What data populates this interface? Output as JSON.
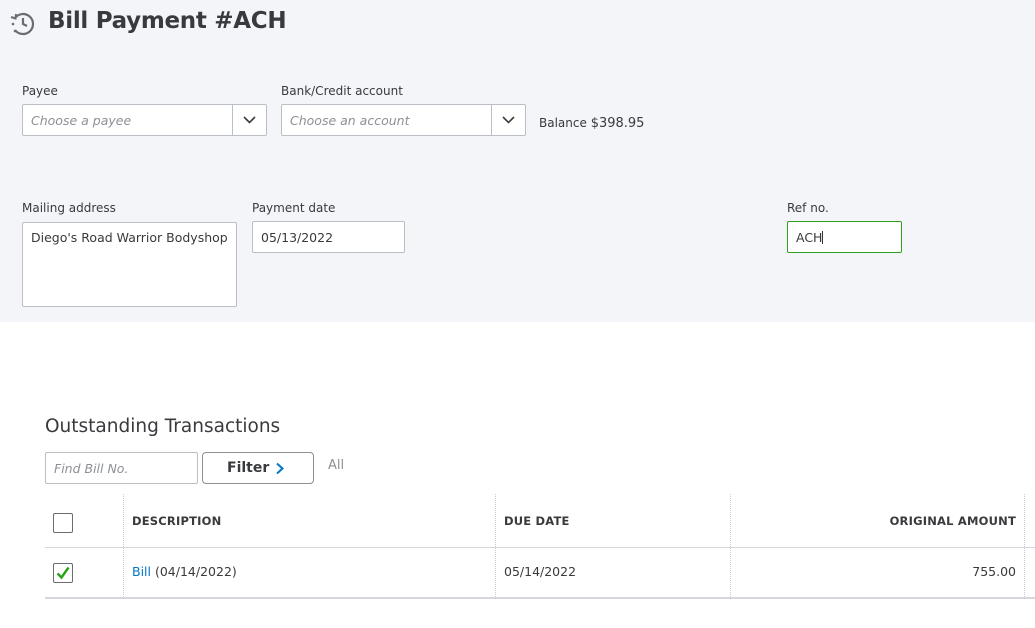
{
  "header": {
    "title": "Bill Payment #ACH",
    "icon": "recurring-clock-icon"
  },
  "form": {
    "payee": {
      "label": "Payee",
      "placeholder": "Choose a payee"
    },
    "bank_account": {
      "label": "Bank/Credit account",
      "placeholder": "Choose an account"
    },
    "balance": {
      "label": "Balance",
      "value": "$398.95"
    },
    "mailing_address": {
      "label": "Mailing address",
      "value": "Diego's Road Warrior Bodyshop"
    },
    "payment_date": {
      "label": "Payment date",
      "value": "05/13/2022"
    },
    "ref_no": {
      "label": "Ref no.",
      "value": "ACH"
    }
  },
  "outstanding": {
    "title": "Outstanding Transactions",
    "find_placeholder": "Find Bill No.",
    "filter_label": "Filter",
    "all_label": "All",
    "columns": {
      "description": "DESCRIPTION",
      "due_date": "DUE DATE",
      "original_amount": "ORIGINAL AMOUNT"
    },
    "rows": [
      {
        "checked": true,
        "link": "Bill",
        "desc_rest": " (04/14/2022)",
        "due_date": "05/14/2022",
        "original_amount": "755.00"
      }
    ]
  },
  "colors": {
    "accent_green": "#2ca01c",
    "link_blue": "#0077c5",
    "panel_bg": "#f4f5f8"
  }
}
